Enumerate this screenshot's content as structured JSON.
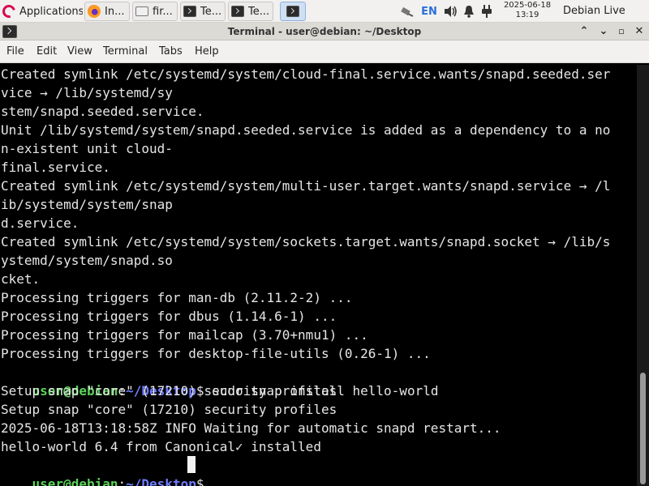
{
  "panel": {
    "apps_menu": "Applications",
    "apps_arrow": "⁝",
    "tasks": [
      {
        "label": "In...",
        "icon": "firefox-icon"
      },
      {
        "label": "fir...",
        "icon": "folder-icon"
      },
      {
        "label": "Te...",
        "icon": "terminal-icon"
      },
      {
        "label": "Te...",
        "icon": "terminal-icon"
      }
    ],
    "language": "EN",
    "clock_date": "2025-06-18",
    "clock_time": "13:19",
    "user_menu": "Debian Live user"
  },
  "window": {
    "title": "Terminal - user@debian: ~/Desktop",
    "minimize": "⌃",
    "maximize": "⌄",
    "restore": "▫",
    "close": "✕"
  },
  "menubar": [
    "File",
    "Edit",
    "View",
    "Terminal",
    "Tabs",
    "Help"
  ],
  "terminal": {
    "output": [
      "Created symlink /etc/systemd/system/cloud-final.service.wants/snapd.seeded.ser",
      "vice → /lib/systemd/sy",
      "stem/snapd.seeded.service.",
      "Unit /lib/systemd/system/snapd.seeded.service is added as a dependency to a no",
      "n-existent unit cloud-",
      "final.service.",
      "Created symlink /etc/systemd/system/multi-user.target.wants/snapd.service → /l",
      "ib/systemd/system/snap",
      "d.service.",
      "Created symlink /etc/systemd/system/sockets.target.wants/snapd.socket → /lib/s",
      "ystemd/system/snapd.so",
      "cket.",
      "Processing triggers for man-db (2.11.2-2) ...",
      "Processing triggers for dbus (1.14.6-1) ...",
      "Processing triggers for mailcap (3.70+nmu1) ...",
      "Processing triggers for desktop-file-utils (0.26-1) ..."
    ],
    "prompt_user": "user@debian",
    "prompt_colon": ":",
    "prompt_path": "~/Desktop",
    "prompt_symbol": "$",
    "command": " sudo snap install hello-world",
    "output2": [
      "Setup snap \"core\" (17210) security profiles",
      "Setup snap \"core\" (17210) security profiles",
      "2025-06-18T13:18:58Z INFO Waiting for automatic snapd restart...",
      "hello-world 6.4 from Canonical✓ installed"
    ],
    "prompt2_user": "user@debian",
    "prompt2_colon": ":",
    "prompt2_path": "~/Desktop",
    "prompt2_symbol": "$"
  },
  "colors": {
    "prompt_user": "#5ad35a",
    "prompt_path": "#6f7cff",
    "terminal_bg": "#000000",
    "terminal_fg": "#e6e6e6"
  }
}
